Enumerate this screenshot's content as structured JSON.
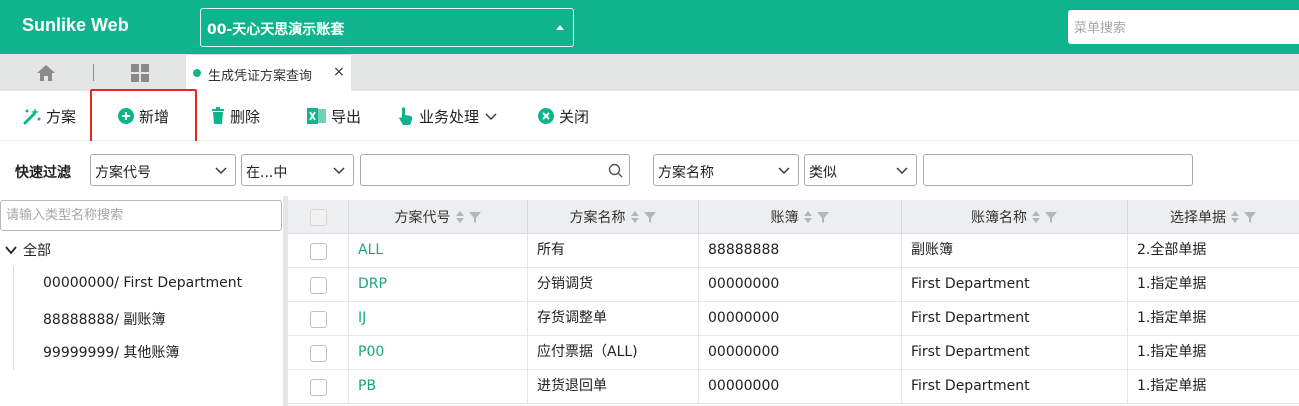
{
  "app": {
    "brand": "Sunlike Web"
  },
  "header": {
    "account_selector": "00-天心天思演示账套",
    "menu_search_placeholder": "菜单搜索"
  },
  "tabs": {
    "home_icon": "home-icon",
    "grid_icon": "apps-grid-icon",
    "active_tab": "生成凭证方案查询",
    "close_glyph": "×"
  },
  "toolbar": {
    "scheme": "方案",
    "add": "新增",
    "delete": "删除",
    "export": "导出",
    "business": "业务处理",
    "close": "关闭"
  },
  "filter": {
    "label": "快速过滤",
    "field1": "方案代号",
    "op1": "在...中",
    "value1": "",
    "field2": "方案名称",
    "op2": "类似",
    "value2": ""
  },
  "tree": {
    "search_placeholder": "请输入类型名称搜索",
    "root": "全部",
    "items": [
      "00000000/ First Department",
      "88888888/ 副账簿",
      "99999999/ 其他账簿"
    ]
  },
  "grid": {
    "columns": [
      "方案代号",
      "方案名称",
      "账簿",
      "账簿名称",
      "选择单据"
    ],
    "rows": [
      {
        "code": "ALL",
        "name": "所有",
        "book": "88888888",
        "book_name": "副账簿",
        "select": "2.全部单据"
      },
      {
        "code": "DRP",
        "name": "分销调货",
        "book": "00000000",
        "book_name": "First Department",
        "select": "1.指定单据"
      },
      {
        "code": "IJ",
        "name": "存货调整单",
        "book": "00000000",
        "book_name": "First Department",
        "select": "1.指定单据"
      },
      {
        "code": "P00",
        "name": "应付票据（ALL)",
        "book": "00000000",
        "book_name": "First Department",
        "select": "1.指定单据"
      },
      {
        "code": "PB",
        "name": "进货退回单",
        "book": "00000000",
        "book_name": "First Department",
        "select": "1.指定单据"
      }
    ]
  },
  "colors": {
    "brand": "#10b48c",
    "link": "#17a77e",
    "highlight": "#e5281e"
  }
}
